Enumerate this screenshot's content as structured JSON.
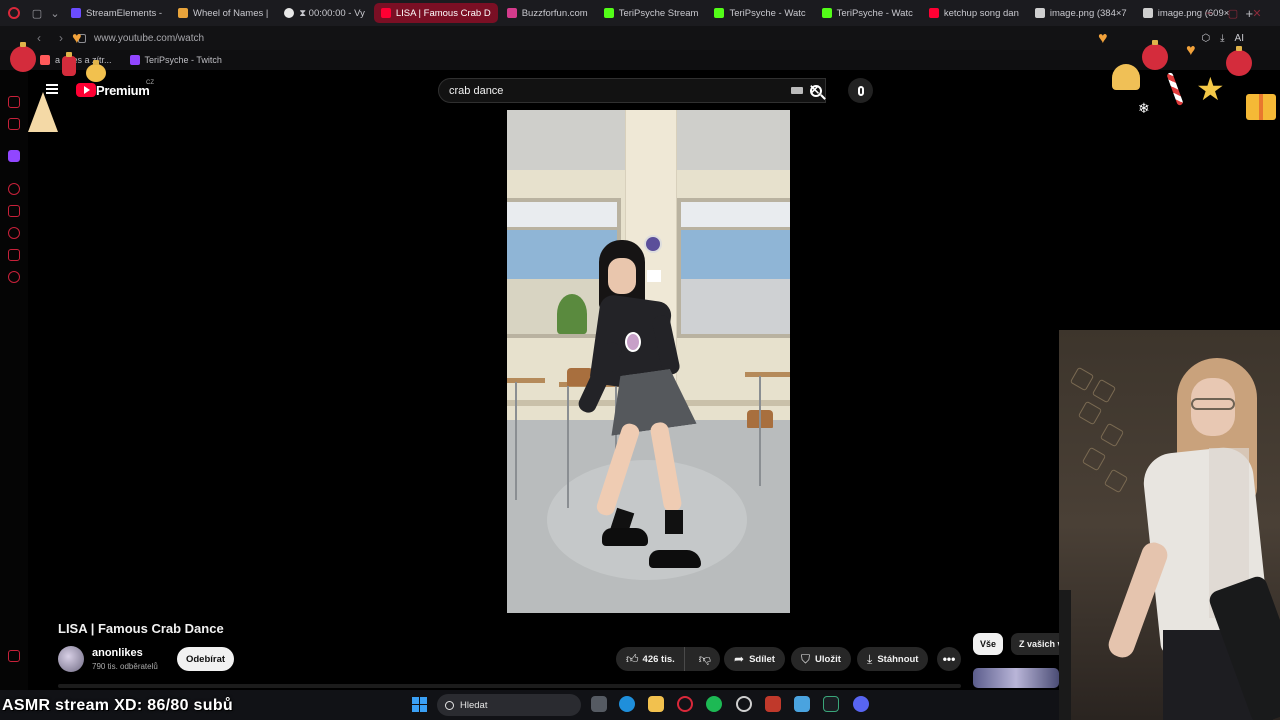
{
  "browser": {
    "tabs": [
      {
        "label": "StreamElements -",
        "color": "#6b4cff"
      },
      {
        "label": "Wheel of Names |",
        "color": "#e9a43b"
      },
      {
        "label": "⧗ 00:00:00 - Vy",
        "color": "#e8e8e8"
      },
      {
        "label": "LISA | Famous Crab D",
        "color": "#ff0033"
      },
      {
        "label": "Buzzforfun.com",
        "color": "#d43b8c"
      },
      {
        "label": "TeriPsyche Stream",
        "color": "#53fc18"
      },
      {
        "label": "TeriPsyche - Watc",
        "color": "#53fc18"
      },
      {
        "label": "TeriPsyche - Watc",
        "color": "#53fc18"
      },
      {
        "label": "ketchup song dan",
        "color": "#ff0033"
      },
      {
        "label": "image.png (384×7",
        "color": "#cfcfcf"
      },
      {
        "label": "image.png (609×",
        "color": "#cfcfcf"
      }
    ],
    "new_tab": "+",
    "url": "www.youtube.com/watch",
    "ai_label": "AI",
    "bookmarks": [
      {
        "label": "a dnes a zítr..."
      },
      {
        "label": "TeriPsyche - Twitch"
      }
    ]
  },
  "youtube": {
    "brand": "Premium",
    "country": "CZ",
    "search_value": "crab dance",
    "clear_glyph": "✕",
    "video_title": "LISA | Famous Crab Dance",
    "channel_name": "anonlikes",
    "channel_subs": "790 tis. odběratelů",
    "subscribe_label": "Odebírat",
    "like_count": "426 tis.",
    "share_label": "Sdílet",
    "save_label": "Uložit",
    "download_label": "Stáhnout",
    "more_glyph": "•••",
    "chips": [
      "Vše",
      "Z vašich v"
    ]
  },
  "taskbar": {
    "search_placeholder": "Hledat"
  },
  "stream_overlay": {
    "caption": "ASMR stream XD: 86/80 subů"
  },
  "colors": {
    "opera_red": "#d9283a",
    "youtube_red": "#ff0033",
    "active_tab": "#7a0f24"
  }
}
